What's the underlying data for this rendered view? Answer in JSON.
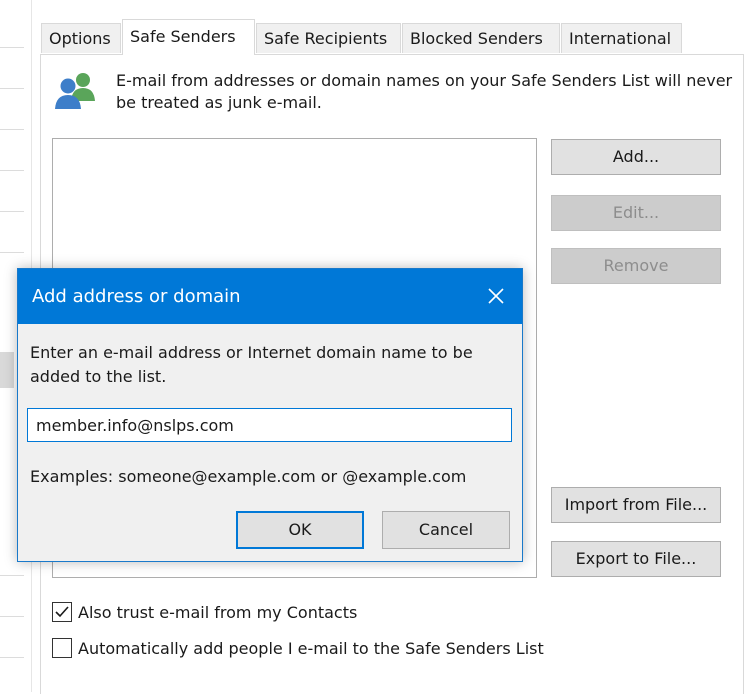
{
  "tabs": [
    {
      "label": "Options"
    },
    {
      "label": "Safe Senders"
    },
    {
      "label": "Safe Recipients"
    },
    {
      "label": "Blocked Senders"
    },
    {
      "label": "International"
    }
  ],
  "active_tab": "Safe Senders",
  "description": "E-mail from addresses or domain names on your Safe Senders List will never be treated as junk e-mail.",
  "buttons": {
    "add": "Add...",
    "edit": "Edit...",
    "remove": "Remove",
    "import": "Import from File...",
    "export": "Export to File..."
  },
  "checkboxes": [
    {
      "label": "Also trust e-mail from my Contacts",
      "checked": true
    },
    {
      "label": "Automatically add people I e-mail to the Safe Senders List",
      "checked": false
    }
  ],
  "dialog": {
    "title": "Add address or domain",
    "prompt": "Enter an e-mail address or Internet domain name to be added to the list.",
    "input_value": "member.info@nslps.com",
    "examples": "Examples: someone@example.com or @example.com",
    "ok": "OK",
    "cancel": "Cancel"
  },
  "colors": {
    "accent": "#0078d7",
    "icon_blue": "#3d7ec9",
    "icon_green": "#5aa55a"
  },
  "icons": {
    "people": "people-icon",
    "close": "close-icon",
    "check": "checkmark-icon"
  }
}
